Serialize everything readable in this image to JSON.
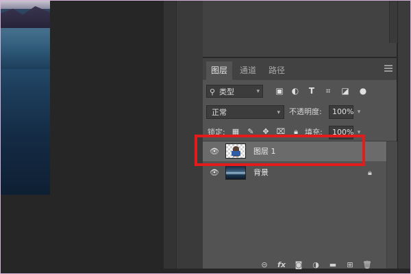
{
  "tabs": [
    {
      "label": "图层",
      "active": true
    },
    {
      "label": "通道",
      "active": false
    },
    {
      "label": "路径",
      "active": false
    }
  ],
  "filter": {
    "kind_label": "类型",
    "icons": [
      "image-filter-icon",
      "adjustment-filter-icon",
      "type-filter-icon",
      "shape-filter-icon",
      "smart-object-filter-icon",
      "filter-toggle-icon"
    ]
  },
  "blend": {
    "mode": "正常",
    "opacity_label": "不透明度:",
    "opacity_value": "100%"
  },
  "lock": {
    "label": "锁定:",
    "icons": [
      "lock-transparency-icon",
      "lock-pixels-icon",
      "lock-position-icon",
      "lock-artboard-icon",
      "lock-all-icon"
    ],
    "fill_label": "填充:",
    "fill_value": "100%"
  },
  "layers": [
    {
      "name": "图层 1",
      "selected": true,
      "visible": true,
      "locked": false
    },
    {
      "name": "背景",
      "selected": false,
      "visible": true,
      "locked": true
    }
  ],
  "bottom_toolbar": [
    "link-layers-icon",
    "fx-icon",
    "add-mask-icon",
    "adjustment-layer-icon",
    "new-group-icon",
    "new-layer-icon",
    "delete-layer-icon"
  ],
  "bottom_fx_label": "fx",
  "colors": {
    "panel_bg": "#535353",
    "selected_row": "#6b6b6b",
    "highlight": "#e51a1a",
    "tab_bar": "#424242"
  }
}
